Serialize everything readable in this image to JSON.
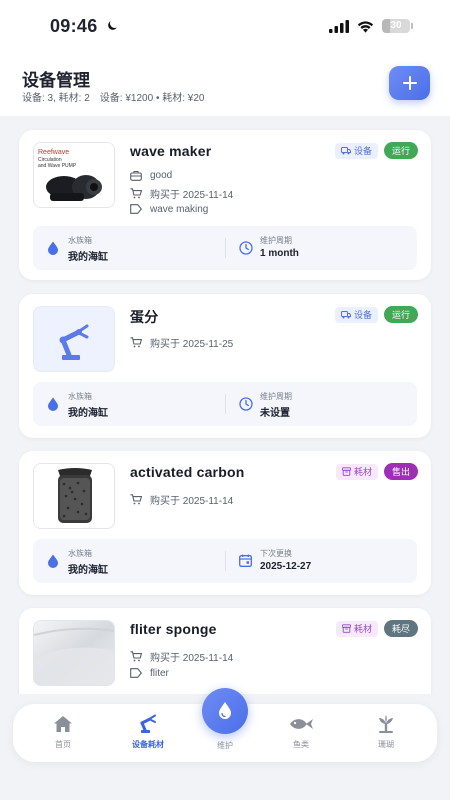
{
  "status_bar": {
    "time": "09:46",
    "battery": "30",
    "battery_level": 0.3
  },
  "header": {
    "title": "设备管理",
    "summary_counts": "设备: 3, 耗材: 2",
    "summary_costs": "设备: ¥1200 • 耗材: ¥20"
  },
  "labels": {
    "tank": "水族箱",
    "maintenance_cycle": "维护周期",
    "next_replace": "下次更换"
  },
  "items": [
    {
      "name": "wave maker",
      "type_label": "设备",
      "status_label": "运行",
      "status_color": "#43a756",
      "condition": "good",
      "purchase": "购买于 2025-11-14",
      "tag": "wave making",
      "tank": "我的海缸",
      "extra_value": "1 month",
      "thumb_text_1": "Circulation",
      "thumb_text_2": "and Wave PUMP",
      "thumb_brand": "Reefwave"
    },
    {
      "name": "蛋分",
      "type_label": "设备",
      "status_label": "运行",
      "status_color": "#43a756",
      "purchase": "购买于 2025-11-25",
      "tank": "我的海缸",
      "extra_value": "未设置"
    },
    {
      "name": "activated carbon",
      "type_label": "耗材",
      "status_label": "售出",
      "status_color": "#9c2fb3",
      "purchase": "购买于 2025-11-14",
      "tank": "我的海缸",
      "extra_value": "2025-12-27"
    },
    {
      "name": "fliter sponge",
      "type_label": "耗材",
      "status_label": "耗尽",
      "status_color": "#5f7580",
      "purchase": "购买于 2025-11-14",
      "tag": "fliter"
    }
  ],
  "tabs": [
    {
      "label": "首页",
      "icon": "home-icon"
    },
    {
      "label": "设备耗材",
      "icon": "robot-arm-icon"
    },
    {
      "label": "维护",
      "icon": "water-drop-icon"
    },
    {
      "label": "鱼类",
      "icon": "fish-icon"
    },
    {
      "label": "珊瑚",
      "icon": "coral-icon"
    }
  ],
  "colors": {
    "accent": "#4b6fe8",
    "running": "#43a756",
    "sold": "#9c2fb3",
    "depleted": "#5f7580"
  }
}
